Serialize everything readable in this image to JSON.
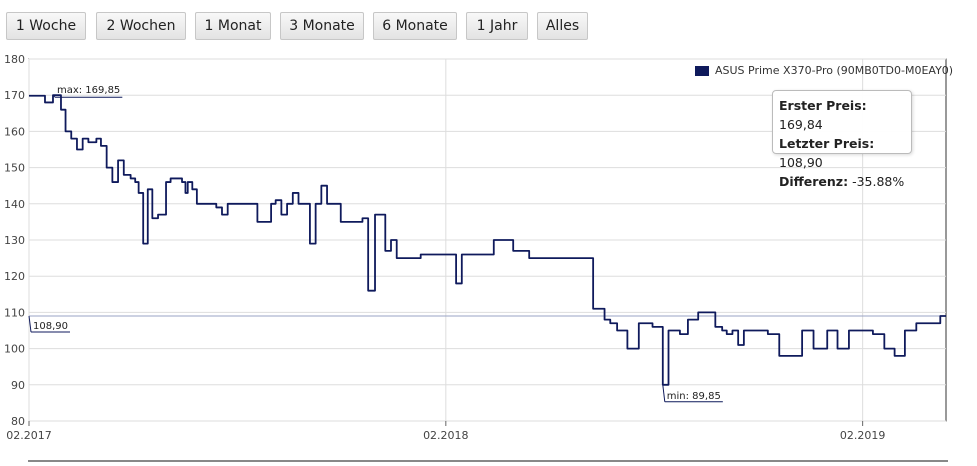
{
  "toolbar": {
    "buttons": [
      {
        "label": "1 Woche"
      },
      {
        "label": "2 Wochen"
      },
      {
        "label": "1 Monat"
      },
      {
        "label": "3 Monate"
      },
      {
        "label": "6 Monate"
      },
      {
        "label": "1 Jahr"
      },
      {
        "label": "Alles"
      }
    ]
  },
  "legend": {
    "label": "ASUS Prime X370-Pro (90MB0TD0-M0EAY0)",
    "color": "#0f1a5c"
  },
  "stats": {
    "first_label": "Erster Preis:",
    "first_value": "169,84",
    "last_label": "Letzter Preis:",
    "last_value": "108,90",
    "diff_label": "Differenz:",
    "diff_value": "-35.88%"
  },
  "annotations": {
    "max": "max: 169,85",
    "min": "min: 89,85",
    "current": "108,90"
  },
  "chart_data": {
    "type": "line",
    "title": "",
    "xlabel": "",
    "ylabel": "",
    "ylim": [
      80,
      180
    ],
    "yticks": [
      80,
      90,
      100,
      110,
      120,
      130,
      140,
      150,
      160,
      170,
      180
    ],
    "xlim": [
      "2017-02-01",
      "2019-04-15"
    ],
    "xticks": [
      {
        "date": "2017-02-01",
        "label": "02.2017"
      },
      {
        "date": "2018-02-01",
        "label": "02.2018"
      },
      {
        "date": "2019-02-01",
        "label": "02.2019"
      }
    ],
    "grid": true,
    "legend_position": "top-right",
    "series": [
      {
        "name": "ASUS Prime X370-Pro (90MB0TD0-M0EAY0)",
        "color": "#0f1a5c",
        "x": [
          "2017-02-01",
          "2017-02-08",
          "2017-02-15",
          "2017-02-22",
          "2017-03-01",
          "2017-03-05",
          "2017-03-10",
          "2017-03-15",
          "2017-03-20",
          "2017-03-25",
          "2017-04-01",
          "2017-04-05",
          "2017-04-10",
          "2017-04-15",
          "2017-04-20",
          "2017-04-25",
          "2017-05-01",
          "2017-05-05",
          "2017-05-08",
          "2017-05-12",
          "2017-05-16",
          "2017-05-20",
          "2017-05-25",
          "2017-06-01",
          "2017-06-05",
          "2017-06-10",
          "2017-06-15",
          "2017-06-18",
          "2017-06-20",
          "2017-06-24",
          "2017-06-28",
          "2017-07-05",
          "2017-07-15",
          "2017-07-20",
          "2017-07-25",
          "2017-08-10",
          "2017-08-20",
          "2017-09-01",
          "2017-09-05",
          "2017-09-10",
          "2017-09-15",
          "2017-09-20",
          "2017-09-25",
          "2017-10-01",
          "2017-10-05",
          "2017-10-10",
          "2017-10-15",
          "2017-10-20",
          "2017-10-25",
          "2017-11-01",
          "2017-11-05",
          "2017-11-10",
          "2017-11-15",
          "2017-11-20",
          "2017-11-25",
          "2017-12-01",
          "2017-12-05",
          "2017-12-10",
          "2017-12-15",
          "2017-12-20",
          "2017-12-25",
          "2018-01-01",
          "2018-01-10",
          "2018-01-15",
          "2018-01-20",
          "2018-01-25",
          "2018-02-01",
          "2018-02-05",
          "2018-02-10",
          "2018-02-15",
          "2018-02-20",
          "2018-02-25",
          "2018-03-01",
          "2018-03-05",
          "2018-03-10",
          "2018-03-15",
          "2018-03-20",
          "2018-04-01",
          "2018-04-15",
          "2018-05-01",
          "2018-05-20",
          "2018-06-10",
          "2018-06-20",
          "2018-06-25",
          "2018-07-01",
          "2018-07-10",
          "2018-07-20",
          "2018-08-01",
          "2018-08-10",
          "2018-08-15",
          "2018-08-25",
          "2018-09-01",
          "2018-09-10",
          "2018-09-20",
          "2018-09-25",
          "2018-10-01",
          "2018-10-05",
          "2018-10-10",
          "2018-10-15",
          "2018-10-20",
          "2018-10-25",
          "2018-11-01",
          "2018-11-10",
          "2018-11-20",
          "2018-12-01",
          "2018-12-10",
          "2018-12-20",
          "2019-01-01",
          "2019-01-10",
          "2019-01-20",
          "2019-02-01",
          "2019-02-10",
          "2019-02-20",
          "2019-03-01",
          "2019-03-10",
          "2019-03-20",
          "2019-04-01",
          "2019-04-10",
          "2019-04-15"
        ],
        "values": [
          169.84,
          169.85,
          168,
          170,
          166,
          160,
          158,
          155,
          158,
          157,
          158,
          156,
          150,
          146,
          152,
          148,
          147,
          146,
          143,
          129,
          144,
          136,
          137,
          146,
          147,
          147,
          146,
          143,
          146,
          144,
          140,
          140,
          139,
          137,
          140,
          140,
          135,
          140,
          141,
          137,
          140,
          143,
          140,
          140,
          129,
          140,
          145,
          140,
          140,
          135,
          135,
          135,
          135,
          136,
          116,
          137,
          137,
          127,
          130,
          125,
          125,
          125,
          126,
          126,
          126,
          126,
          126,
          126,
          118,
          126,
          126,
          126,
          126,
          126,
          126,
          130,
          130,
          127,
          125,
          125,
          125,
          111,
          108,
          107,
          105,
          100,
          107,
          106,
          90,
          105,
          104,
          108,
          110,
          110,
          106,
          105,
          104,
          105,
          101,
          105,
          105,
          105,
          104,
          98,
          98,
          105,
          100,
          105,
          100,
          105,
          105,
          104,
          100,
          98,
          105,
          107,
          107,
          109,
          109
        ]
      }
    ]
  }
}
